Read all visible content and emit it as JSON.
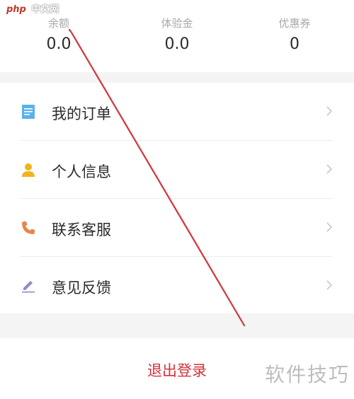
{
  "stats": [
    {
      "label": "余额",
      "value": "0.0"
    },
    {
      "label": "体验金",
      "value": "0.0"
    },
    {
      "label": "优惠券",
      "value": "0"
    }
  ],
  "menu": [
    {
      "label": "我的订单",
      "icon": "order-list-icon",
      "color": "#5ab1e8"
    },
    {
      "label": "个人信息",
      "icon": "user-icon",
      "color": "#f2b31c"
    },
    {
      "label": "联系客服",
      "icon": "phone-icon",
      "color": "#e8854a"
    },
    {
      "label": "意见反馈",
      "icon": "pencil-icon",
      "color": "#8c8cc8"
    }
  ],
  "logout": {
    "label": "退出登录",
    "color": "#d2333a"
  },
  "watermarks": {
    "top_php": "php",
    "top_cn": "中文网",
    "bottom": "软件技巧"
  }
}
